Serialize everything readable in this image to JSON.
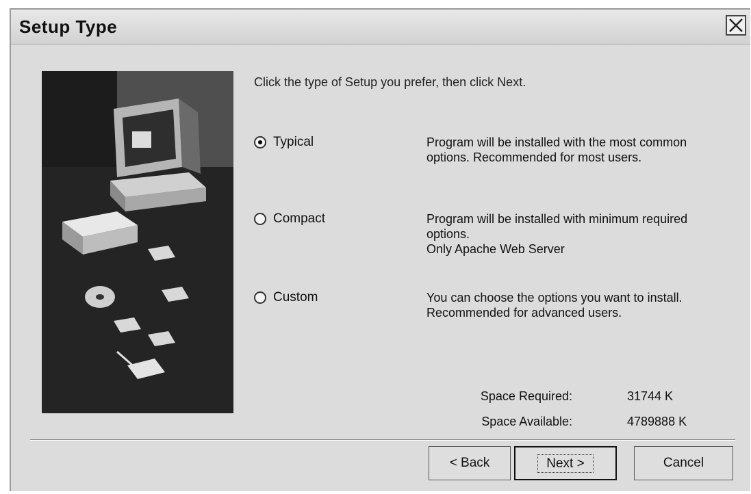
{
  "window": {
    "title": "Setup Type"
  },
  "prompt": "Click the type of Setup you prefer, then click Next.",
  "options": [
    {
      "label": "Typical",
      "selected": true,
      "description": [
        "Program will be installed with the most common",
        "options. Recommended for most users."
      ]
    },
    {
      "label": "Compact",
      "selected": false,
      "description": [
        "Program will be installed with minimum required",
        "options.",
        "Only Apache Web Server"
      ]
    },
    {
      "label": "Custom",
      "selected": false,
      "description": [
        "You can choose the options you want to install.",
        "Recommended for advanced users."
      ]
    }
  ],
  "space": {
    "required_label": "Space Required:",
    "required_value": "31744 K",
    "available_label": "Space Available:",
    "available_value": "4789888 K"
  },
  "buttons": {
    "back": "< Back",
    "next": "Next >",
    "cancel": "Cancel"
  },
  "icons": {
    "close": "close-icon",
    "side_image": "setup-computer-illustration"
  }
}
